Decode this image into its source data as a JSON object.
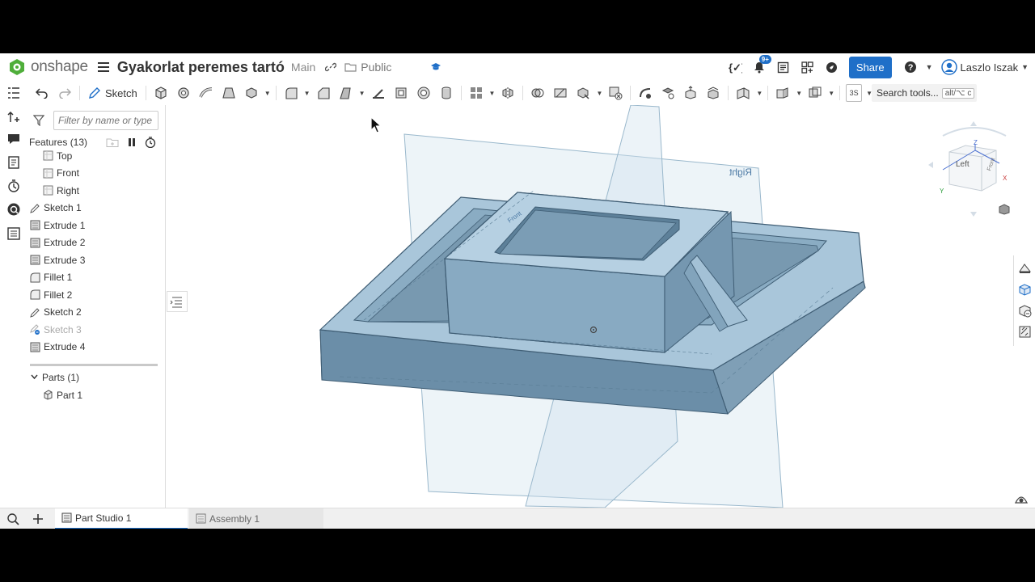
{
  "app": {
    "brand": "onshape",
    "doc_title": "Gyakorlat peremes tartó",
    "branch": "Main",
    "folder": "Public",
    "notification_badge": "9+",
    "share_label": "Share",
    "user_name": "Laszlo Iszak",
    "brand_color": "#1f6fc8"
  },
  "toolbar": {
    "sketch_label": "Sketch",
    "search_label": "Search tools...",
    "search_shortcut": "alt/⌥ c",
    "view_label": "3S"
  },
  "features": {
    "filter_placeholder": "Filter by name or type",
    "header": "Features (13)",
    "items": [
      {
        "label": "Top",
        "type": "plane"
      },
      {
        "label": "Front",
        "type": "plane"
      },
      {
        "label": "Right",
        "type": "plane"
      },
      {
        "label": "Sketch 1",
        "type": "sketch"
      },
      {
        "label": "Extrude 1",
        "type": "extrude"
      },
      {
        "label": "Extrude 2",
        "type": "extrude"
      },
      {
        "label": "Extrude 3",
        "type": "extrude"
      },
      {
        "label": "Fillet 1",
        "type": "fillet"
      },
      {
        "label": "Fillet 2",
        "type": "fillet"
      },
      {
        "label": "Sketch 2",
        "type": "sketch"
      },
      {
        "label": "Sketch 3",
        "type": "sketch-rolled"
      },
      {
        "label": "Extrude 4",
        "type": "extrude"
      }
    ],
    "parts_header": "Parts (1)",
    "parts": [
      {
        "label": "Part 1"
      }
    ]
  },
  "viewport": {
    "plane_right_label": "Right",
    "plane_front_label": "Front",
    "view_cube": {
      "face_label": "Left",
      "side_label": "Front",
      "axis_z": "Z",
      "axis_y": "Y",
      "axis_x": "X"
    }
  },
  "tabs": [
    {
      "label": "Part Studio 1",
      "active": true
    },
    {
      "label": "Assembly 1",
      "active": false
    }
  ]
}
